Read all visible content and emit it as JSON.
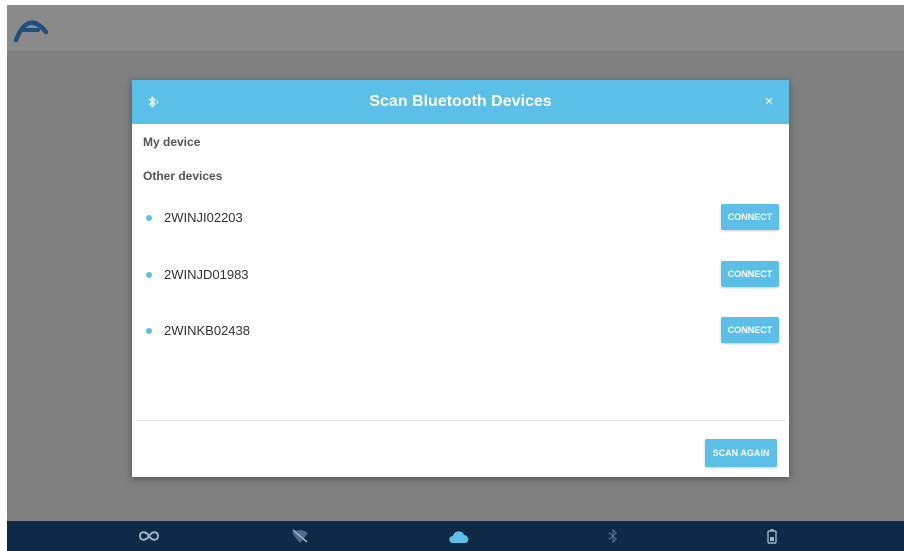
{
  "dialog": {
    "title": "Scan Bluetooth Devices",
    "close_label": "×",
    "my_device_label": "My device",
    "other_devices_label": "Other devices",
    "devices": [
      {
        "name": "2WINJI02203",
        "action_label": "CONNECT"
      },
      {
        "name": "2WINJD01983",
        "action_label": "CONNECT"
      },
      {
        "name": "2WINKB02438",
        "action_label": "CONNECT"
      }
    ],
    "scan_again_label": "SCAN AGAIN"
  },
  "bottom_nav": {
    "items": [
      {
        "icon": "infinity-icon"
      },
      {
        "icon": "wifi-off-icon"
      },
      {
        "icon": "cloud-icon"
      },
      {
        "icon": "bluetooth-icon"
      },
      {
        "icon": "battery-icon"
      }
    ]
  },
  "colors": {
    "accent": "#5bbfe8",
    "overlay": "#808080",
    "nav_background": "#0e2a47"
  }
}
